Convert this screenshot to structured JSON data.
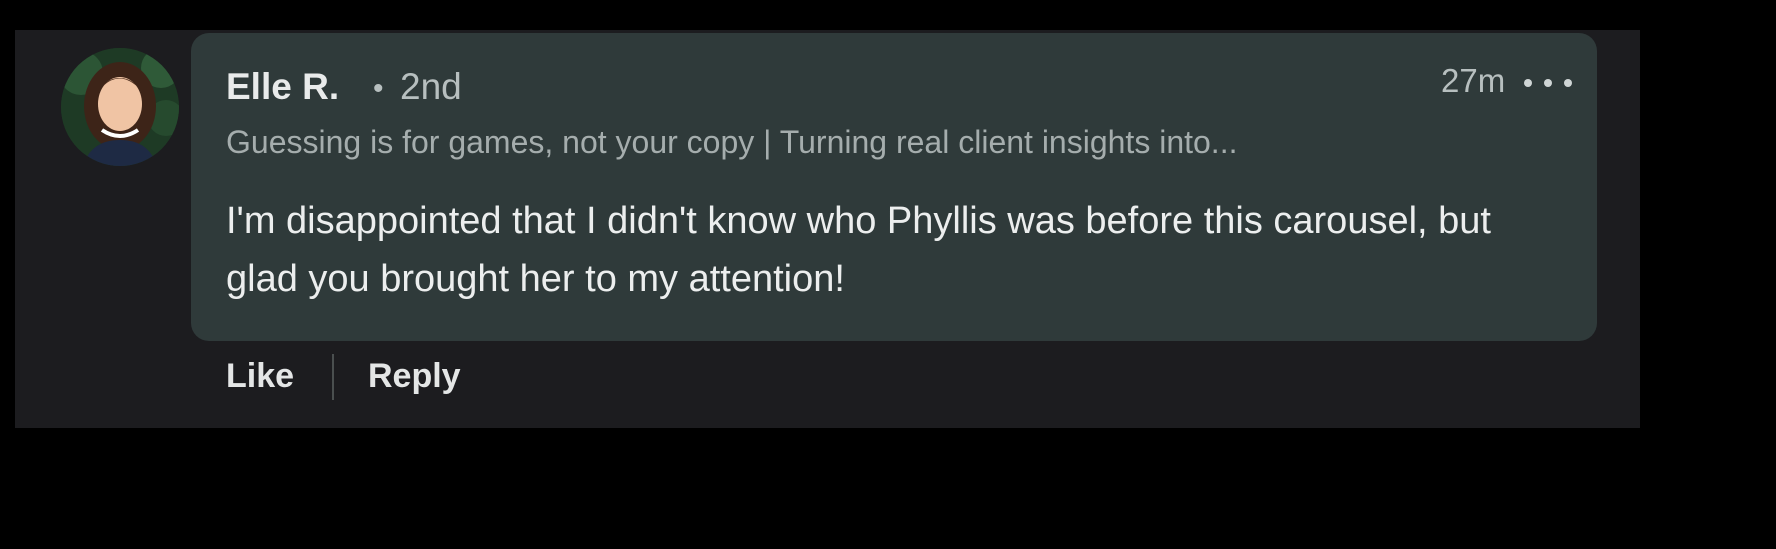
{
  "comment": {
    "author_name": "Elle R.",
    "separator": "•",
    "connection_degree": "2nd",
    "headline": "Guessing is for games, not your copy | Turning real client insights into...",
    "timestamp": "27m",
    "text": "I'm disappointed that I didn't know who Phyllis was before this carousel, but glad you brought her to my attention!",
    "avatar_icon": "profile-photo"
  },
  "actions": {
    "like_label": "Like",
    "reply_label": "Reply"
  },
  "colors": {
    "page_background": "#000000",
    "panel_background": "#1c1c1f",
    "bubble_background": "#2f3a3a",
    "primary_text": "#e9ebeb",
    "secondary_text": "#b7bfbf"
  }
}
